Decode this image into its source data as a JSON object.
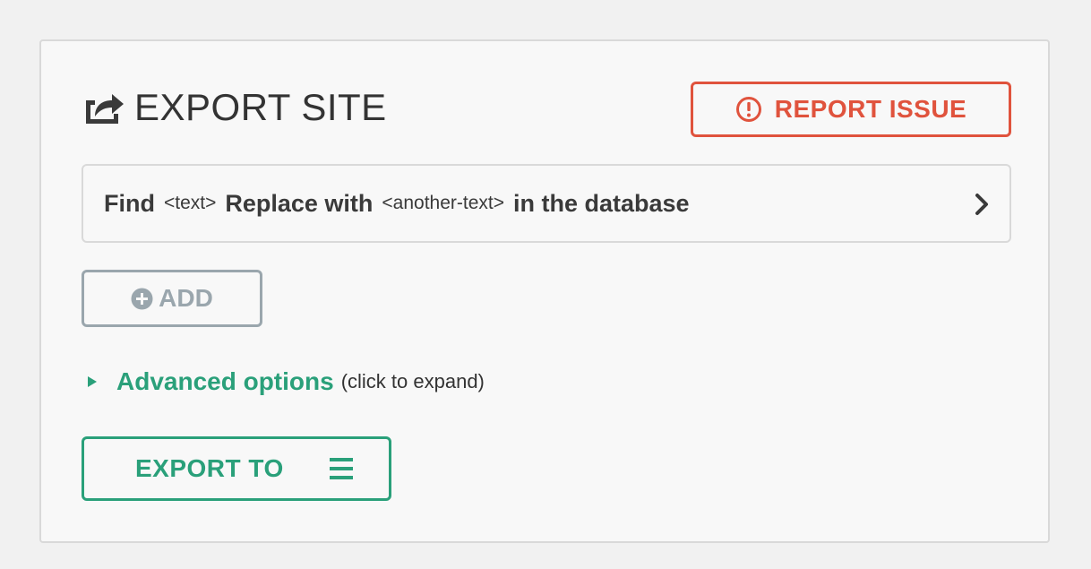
{
  "header": {
    "title": "EXPORT SITE",
    "report_label": "REPORT ISSUE"
  },
  "replace": {
    "find_label": "Find",
    "find_value": "<text>",
    "replace_label": "Replace with",
    "replace_value": "<another-text>",
    "suffix": "in the database"
  },
  "add": {
    "label": "ADD"
  },
  "advanced": {
    "link": "Advanced options",
    "hint": "(click to expand)"
  },
  "export": {
    "label": "EXPORT TO"
  },
  "colors": {
    "accent_green": "#2aa07a",
    "alert_red": "#e0533d",
    "muted_gray": "#9aa6ad"
  },
  "icons": {
    "title": "share-export-icon",
    "report": "alert-circle-icon",
    "row": "chevron-right-icon",
    "add": "plus-circle-icon",
    "advanced": "triangle-right-icon",
    "export": "hamburger-menu-icon"
  }
}
